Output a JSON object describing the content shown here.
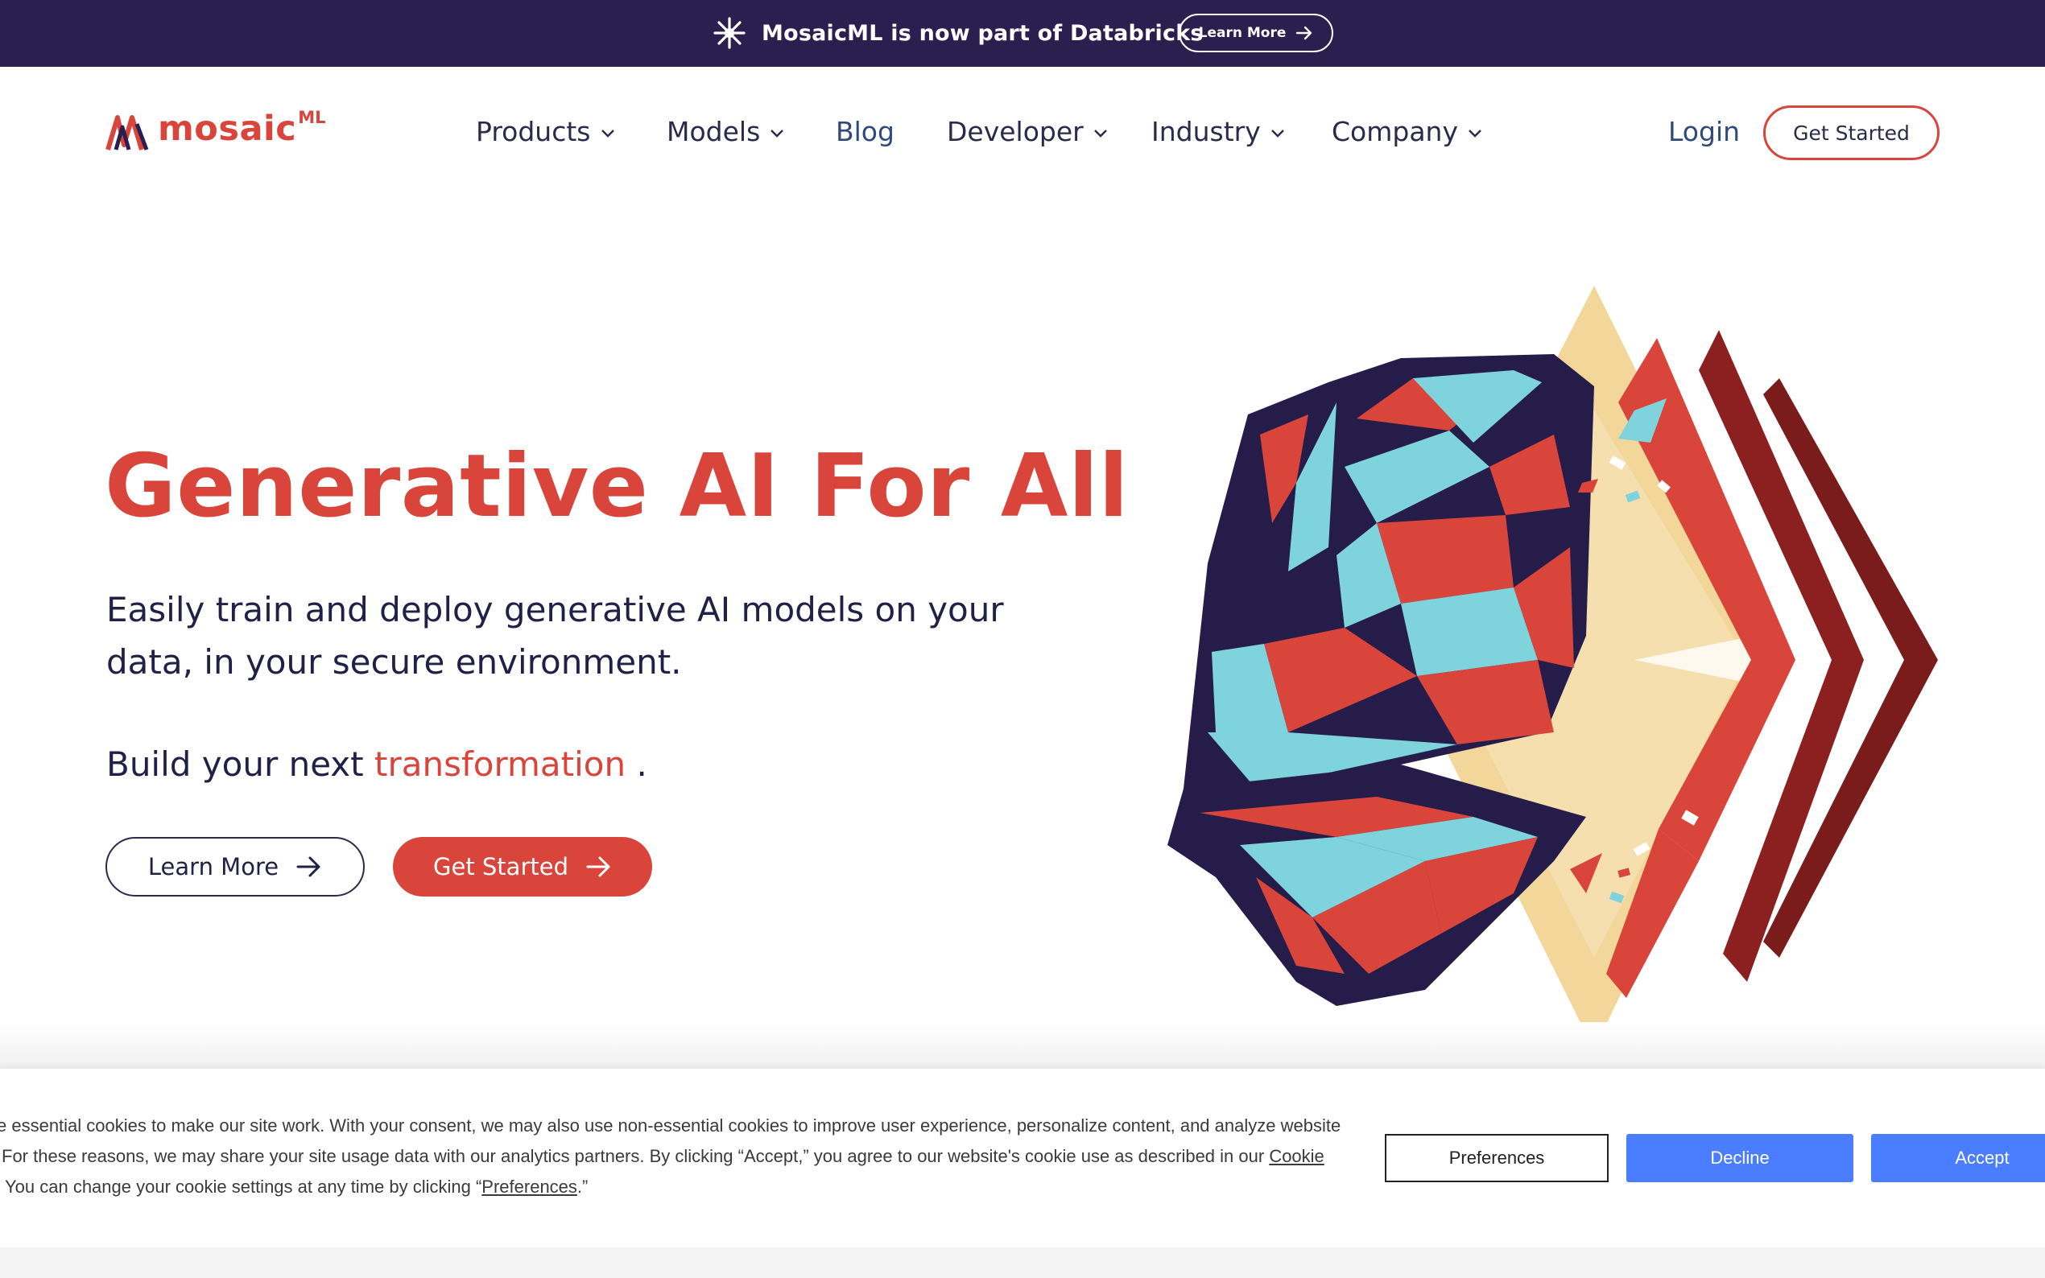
{
  "colors": {
    "banner_bg": "#2a1f4f",
    "brand_red": "#d9453b",
    "navy_text": "#232048",
    "cookie_button_blue": "#4a7dff"
  },
  "banner": {
    "icon": "sparkle-icon",
    "text": "MosaicML is now part of Databricks",
    "button_label": "Learn More"
  },
  "header": {
    "logo_word": "mosaic",
    "logo_superscript": "ML",
    "nav": [
      {
        "label": "Products",
        "has_dropdown": true
      },
      {
        "label": "Models",
        "has_dropdown": true
      },
      {
        "label": "Blog",
        "has_dropdown": false
      },
      {
        "label": "Developer",
        "has_dropdown": true
      },
      {
        "label": "Industry",
        "has_dropdown": true
      },
      {
        "label": "Company",
        "has_dropdown": true
      }
    ],
    "login_label": "Login",
    "get_started_label": "Get Started"
  },
  "hero": {
    "title": "Generative AI For All",
    "subtitle": "Easily train and deploy generative AI models on your data, in your secure environment.",
    "build_prefix": "Build your next",
    "build_accent": "transformation",
    "build_suffix": ".",
    "learn_more_label": "Learn More",
    "get_started_label": "Get Started"
  },
  "cookie": {
    "line1": "e essential cookies to make our site work. With your consent, we may also use non-essential cookies to improve user experience, personalize content, and analyze website",
    "line2_prefix": "For these reasons, we may share your site usage data with our analytics partners. By clicking “Accept,” you agree to our website's cookie use as described in our",
    "line2_link": "Cookie",
    "line3_prefix": "You can change your cookie settings at any time by clicking “",
    "line3_link": "Preferences",
    "line3_suffix": ".”",
    "preferences_label": "Preferences",
    "decline_label": "Decline",
    "accept_label": "Accept"
  }
}
